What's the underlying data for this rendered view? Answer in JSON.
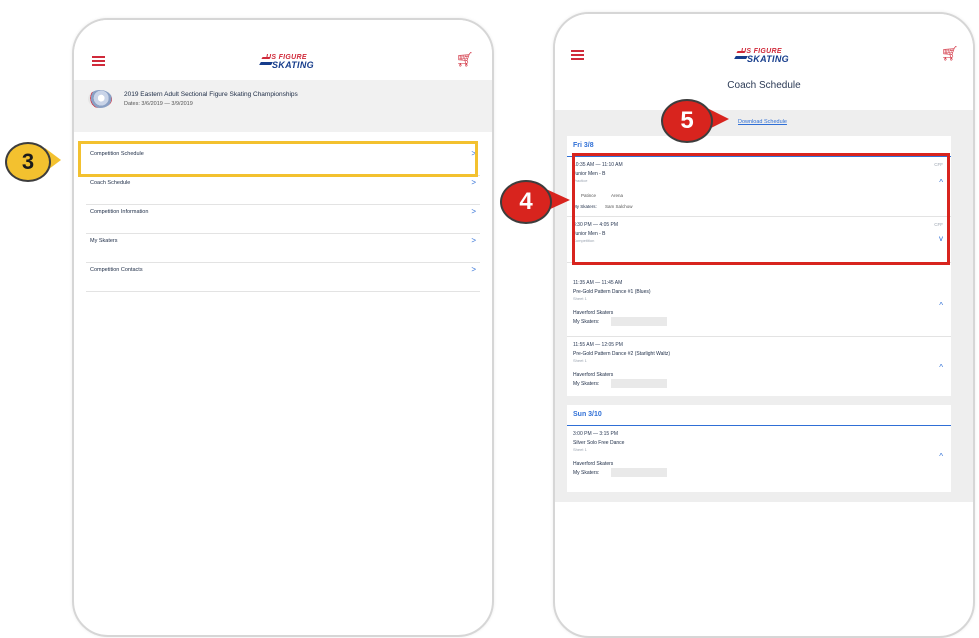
{
  "colors": {
    "accent": "#2f6fd6",
    "brand_red": "#d02a3a",
    "highlight_yellow": "#f3c12f",
    "highlight_red": "#d8241e"
  },
  "icons": {
    "menu": "hamburger-icon",
    "cart": "cart-icon",
    "chevron_right": "chevron-right-icon",
    "chevron_up": "chevron-up-icon",
    "chevron_down": "chevron-down-icon"
  },
  "logo": {
    "line1": "US FIGURE",
    "line2": "SKATING"
  },
  "left": {
    "competition": {
      "title": "2019 Eastern Adult Sectional Figure Skating Championships",
      "dates": "Dates: 3/6/2019 — 3/9/2019"
    },
    "menu": [
      {
        "label": "Competition Schedule",
        "chevron": ">"
      },
      {
        "label": "Coach Schedule",
        "chevron": ">"
      },
      {
        "label": "Competition Information",
        "chevron": ">"
      },
      {
        "label": "My Skaters",
        "chevron": ">"
      },
      {
        "label": "Competition Contacts",
        "chevron": ">"
      }
    ]
  },
  "right": {
    "page_title": "Coach Schedule",
    "download_link": "Download Schedule",
    "days": [
      {
        "label": "Fri 3/8",
        "events": [
          {
            "time": "10:35 AM — 11:10 AM",
            "tag": "CFF",
            "name": "Junior Men - B",
            "sub": "Practice",
            "detail_left": "Patince",
            "detail_right": "Arena",
            "my_label": "My Skaters:",
            "my_value": "Sam Salchow",
            "chevron": "^"
          },
          {
            "time": "3:30 PM — 4:05 PM",
            "tag": "CFF",
            "name": "Junior Men - B",
            "sub": "Competition",
            "chevron": "v"
          },
          {
            "time": "11:35 AM — 11:45 AM",
            "name": "Pre-Gold Pattern Dance #1 (Blues)",
            "sub": "Sheet 1",
            "club": "Haverford Skaters",
            "my_label": "My Skaters:",
            "chevron": "^"
          },
          {
            "time": "11:55 AM — 12:05 PM",
            "name": "Pre-Gold Pattern Dance #2 (Starlight Waltz)",
            "sub": "Sheet 1",
            "club": "Haverford Skaters",
            "my_label": "My Skaters:",
            "chevron": "^"
          }
        ]
      },
      {
        "label": "Sun 3/10",
        "events": [
          {
            "time": "3:00 PM — 3:15 PM",
            "name": "Silver Solo Free Dance",
            "sub": "Sheet 1",
            "club": "Haverford Skaters",
            "my_label": "My Skaters:",
            "chevron": "^"
          }
        ]
      }
    ]
  },
  "callouts": {
    "three": "3",
    "four": "4",
    "five": "5"
  }
}
